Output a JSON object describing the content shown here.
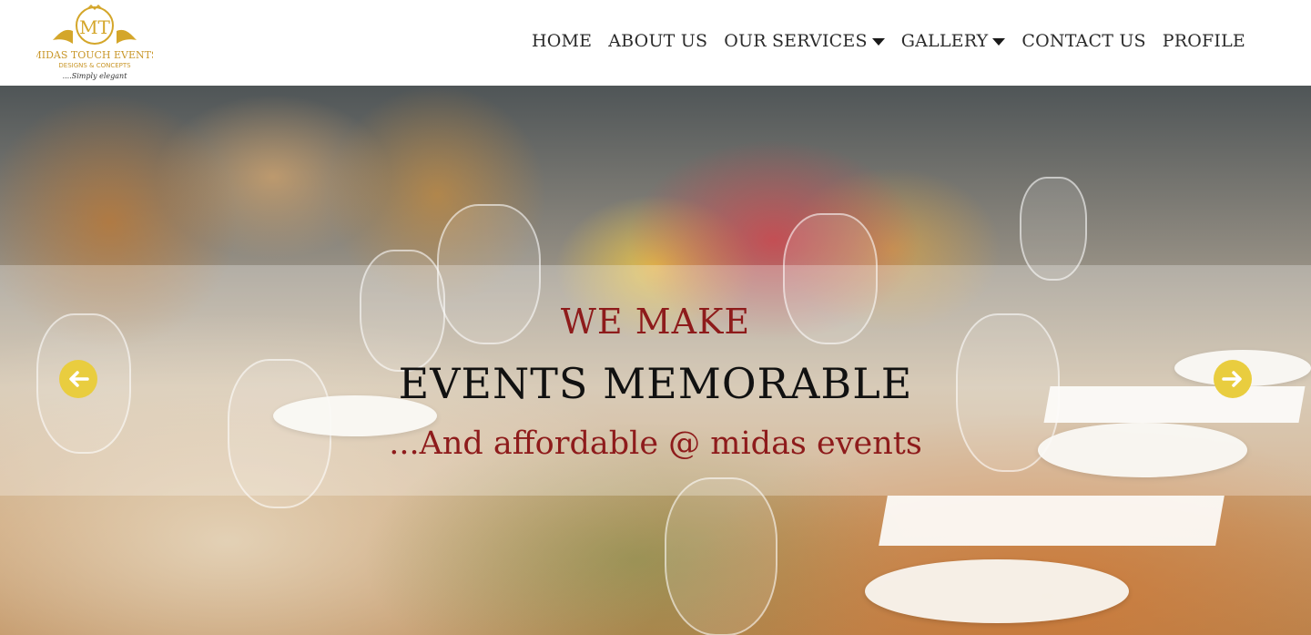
{
  "logo": {
    "monogram": "MT",
    "name": "MIDAS TOUCH EVENTS",
    "subtitle": "DESIGNS & CONCEPTS",
    "tagline": "....Simply elegant"
  },
  "nav": {
    "items": [
      {
        "label": "HOME"
      },
      {
        "label": "ABOUT US"
      },
      {
        "label": "OUR SERVICES"
      },
      {
        "label": "GALLERY"
      },
      {
        "label": "CONTACT US"
      },
      {
        "label": "PROFILE"
      }
    ]
  },
  "hero": {
    "line1": "WE MAKE",
    "line2": "EVENTS MEMORABLE",
    "line3": "...And affordable @ midas events",
    "prev_icon": "arrow-left-icon",
    "next_icon": "arrow-right-icon"
  },
  "colors": {
    "accent_gold": "#e9cd3f",
    "accent_red": "#8e1b1b",
    "nav_text": "#2b2b2b"
  }
}
